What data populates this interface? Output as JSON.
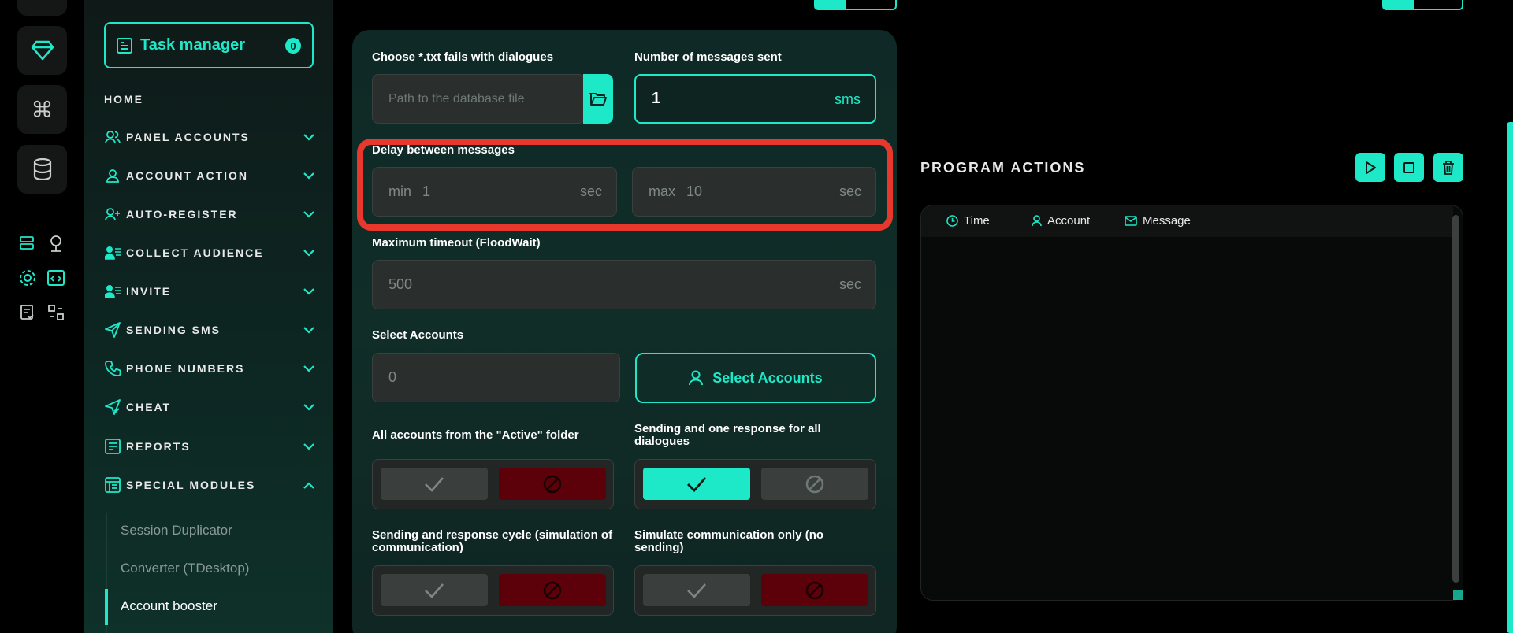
{
  "sidebar": {
    "task_manager": {
      "label": "Task manager",
      "count": "0"
    },
    "home": "HOME",
    "items": [
      {
        "label": "PANEL ACCOUNTS",
        "icon": "users-icon"
      },
      {
        "label": "ACCOUNT ACTION",
        "icon": "user-icon"
      },
      {
        "label": "AUTO-REGISTER",
        "icon": "user-plus-icon"
      },
      {
        "label": "COLLECT AUDIENCE",
        "icon": "audience-icon"
      },
      {
        "label": "INVITE",
        "icon": "invite-icon"
      },
      {
        "label": "SENDING SMS",
        "icon": "send-icon"
      },
      {
        "label": "PHONE NUMBERS",
        "icon": "phone-icon"
      },
      {
        "label": "CHEAT",
        "icon": "cheat-icon"
      },
      {
        "label": "REPORTS",
        "icon": "reports-icon"
      },
      {
        "label": "SPECIAL MODULES",
        "icon": "modules-icon",
        "expanded": true
      }
    ],
    "sub_items": [
      "Session Duplicator",
      "Converter (TDesktop)",
      "Account booster"
    ],
    "active_sub": "Account booster"
  },
  "form": {
    "file_label": "Choose *.txt fails with dialogues",
    "file_placeholder": "Path to the database file",
    "messages_label": "Number of messages sent",
    "messages_value": "1",
    "messages_unit": "sms",
    "delay_label": "Delay between messages",
    "delay_min_prefix": "min",
    "delay_min_value": "1",
    "delay_max_prefix": "max",
    "delay_max_value": "10",
    "delay_unit": "sec",
    "timeout_label": "Maximum timeout (FloodWait)",
    "timeout_value": "500",
    "timeout_unit": "sec",
    "accounts_label": "Select Accounts",
    "accounts_value": "0",
    "select_accounts_btn": "Select Accounts",
    "toggles": [
      {
        "label": "All accounts from the \"Active\" folder",
        "enabled": false
      },
      {
        "label": "Sending and one response for all dialogues",
        "enabled": true
      },
      {
        "label": "Sending and response cycle (simulation of communication)",
        "enabled": false
      },
      {
        "label": "Simulate communication only (no sending)",
        "enabled": false
      }
    ]
  },
  "program_actions": {
    "title": "PROGRAM ACTIONS",
    "columns": [
      "Time",
      "Account",
      "Message"
    ]
  },
  "colors": {
    "accent": "#1de9c8",
    "danger": "#e8372c",
    "disabled_red": "#5c0009"
  }
}
